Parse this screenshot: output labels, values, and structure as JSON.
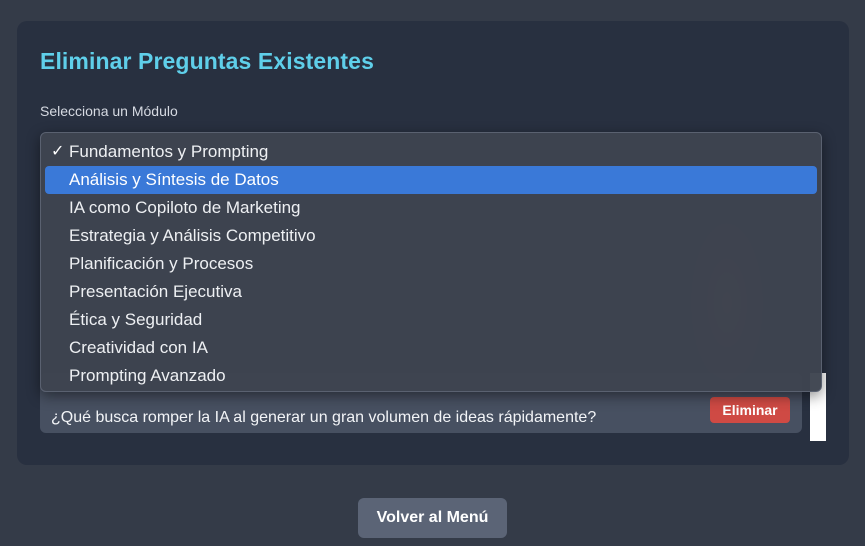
{
  "page": {
    "title": "Eliminar Preguntas Existentes",
    "module_label": "Selecciona un Módulo"
  },
  "module_select": {
    "selected": "Fundamentos y Prompting",
    "highlighted": "Análisis y Síntesis de Datos",
    "options": [
      "Fundamentos y Prompting",
      "Análisis y Síntesis de Datos",
      "IA como Copiloto de Marketing",
      "Estrategia y Análisis Competitivo",
      "Planificación y Procesos",
      "Presentación Ejecutiva",
      "Ética y Seguridad",
      "Creatividad con IA",
      "Prompting Avanzado"
    ]
  },
  "questions": [
    {
      "text": "¿Qué busca romper la IA al generar un gran volumen de ideas rápidamente?",
      "delete_label": "Eliminar"
    }
  ],
  "footer": {
    "back_label": "Volver al Menú"
  },
  "icons": {
    "selected_check": "check-icon"
  },
  "colors": {
    "title": "#5fcfea",
    "highlight": "#3a79d8",
    "danger": "#cf4a44"
  }
}
